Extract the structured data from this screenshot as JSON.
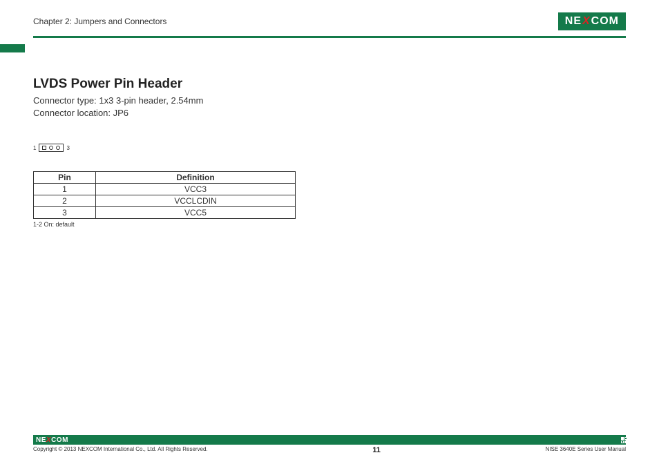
{
  "header": {
    "chapter": "Chapter 2: Jumpers and Connectors",
    "logo_text_parts": {
      "a": "NE",
      "x": "X",
      "b": "COM"
    }
  },
  "section": {
    "title": "LVDS Power Pin Header",
    "line1": "Connector type: 1x3 3-pin header, 2.54mm",
    "line2": "Connector location: JP6"
  },
  "pin_diagram": {
    "left_label": "1",
    "right_label": "3"
  },
  "table": {
    "headers": {
      "pin": "Pin",
      "def": "Definition"
    },
    "rows": [
      {
        "pin": "1",
        "def": "VCC3"
      },
      {
        "pin": "2",
        "def": "VCCLCDIN"
      },
      {
        "pin": "3",
        "def": "VCC5"
      }
    ],
    "note": "1-2 On: default"
  },
  "footer": {
    "copyright": "Copyright © 2013 NEXCOM International Co., Ltd. All Rights Reserved.",
    "page": "11",
    "manual": "NISE 3640E Series User Manual"
  }
}
